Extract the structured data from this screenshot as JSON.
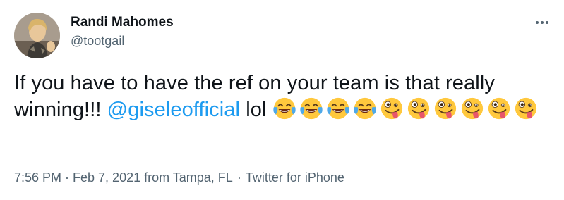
{
  "author": {
    "display_name": "Randi Mahomes",
    "handle": "@tootgail"
  },
  "more_icon": "more-horizontal-icon",
  "tweet": {
    "text_before": "If you have to have the ref on your team is that really winning!!! ",
    "mention": "@giseleofficial",
    "text_after": " lol ",
    "emojis": [
      "face-with-tears-of-joy",
      "face-with-tears-of-joy",
      "face-with-tears-of-joy",
      "face-with-tears-of-joy",
      "zany-face",
      "zany-face",
      "zany-face",
      "zany-face",
      "zany-face",
      "zany-face"
    ]
  },
  "meta": {
    "timestamp": "7:56 PM · Feb 7, 2021 from Tampa, FL",
    "separator": "·",
    "source": "Twitter for iPhone"
  },
  "colors": {
    "link": "#1d9bf0",
    "text": "#0f1419",
    "secondary": "#536471",
    "emoji_yellow": "#ffc83d"
  }
}
